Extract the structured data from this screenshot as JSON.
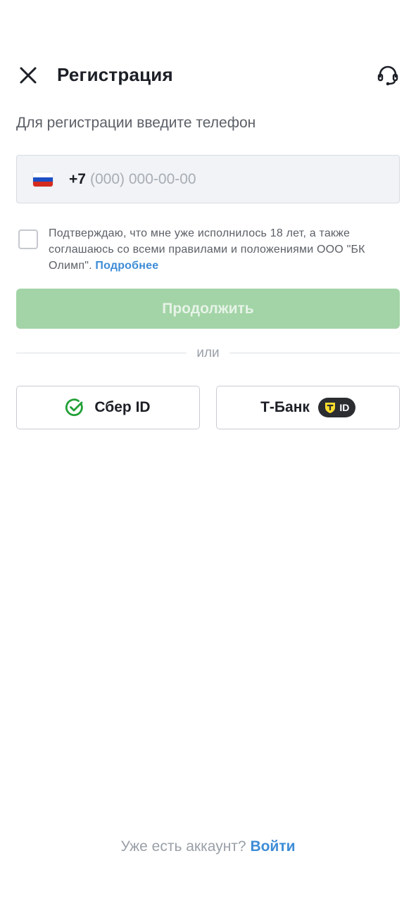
{
  "header": {
    "title": "Регистрация",
    "close_icon": "close-icon",
    "support_icon": "headset-icon"
  },
  "subtitle": "Для регистрации введите телефон",
  "phone": {
    "country_flag": "russia-flag-icon",
    "prefix": "+7",
    "value": "",
    "placeholder": "(000) 000-00-00"
  },
  "consent": {
    "checked": false,
    "text": "Подтверждаю, что мне уже исполнилось 18 лет, а также соглашаюсь со всеми правилами и положениями ООО \"БК Олимп\".",
    "link_label": "Подробнее"
  },
  "continue_button": {
    "label": "Продолжить",
    "enabled": false,
    "color": "#a3d4a7"
  },
  "divider_text": "или",
  "auth_options": {
    "sber": {
      "label": "Сбер ID",
      "icon": "sber-check-icon",
      "accent": "#21a038"
    },
    "tbank": {
      "label": "Т-Банк",
      "badge_text": "ID",
      "icon": "tbank-shield-icon",
      "accent": "#ffdd2d"
    }
  },
  "footer": {
    "question": "Уже есть аккаунт?",
    "login_label": "Войти"
  },
  "colors": {
    "link": "#3d8cd6",
    "text_primary": "#1c1f26",
    "text_secondary": "#5b5f66"
  }
}
